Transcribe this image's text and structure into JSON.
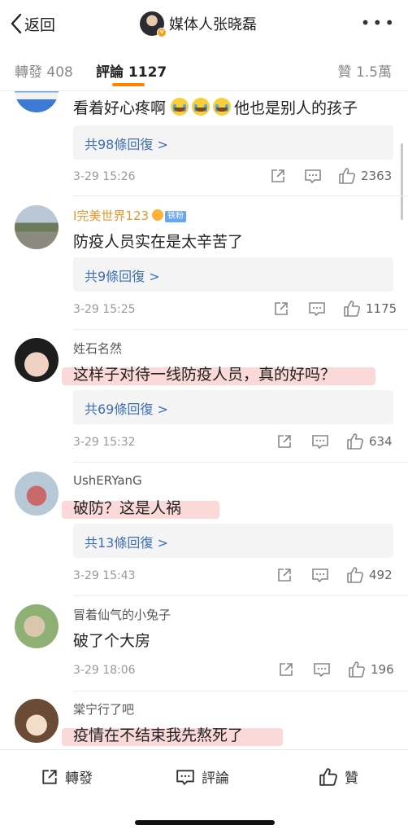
{
  "header": {
    "back_label": "返回",
    "title": "媒体人张晓磊",
    "more_label": "•••"
  },
  "tabs": [
    {
      "label": "轉發",
      "count": "408"
    },
    {
      "label": "評論",
      "count": "1127"
    },
    {
      "label": "贊",
      "count": "1.5萬"
    }
  ],
  "comments": [
    {
      "user": "",
      "text_before": "看着好心疼啊 ",
      "emoji_count": 3,
      "text_after": "他也是别人的孩子",
      "replies": "共98條回復 >",
      "time": "3-29 15:26",
      "likes": "2363"
    },
    {
      "user": "I完美世界123",
      "badge": "铁粉",
      "text": "防疫人员实在是太辛苦了",
      "replies": "共9條回復 >",
      "time": "3-29 15:25",
      "likes": "1175"
    },
    {
      "user": "姓石名然",
      "text": "这样子对待一线防疫人员，真的好吗？",
      "replies": "共69條回復 >",
      "time": "3-29 15:32",
      "likes": "634"
    },
    {
      "user": "UshERYanG",
      "text": "破防？这是人祸",
      "replies": "共13條回復 >",
      "time": "3-29 15:43",
      "likes": "492"
    },
    {
      "user": "冒着仙气的小兔子",
      "text": "破了个大房",
      "time": "3-29 18:06",
      "likes": "196"
    },
    {
      "user": "棠宁行了吧",
      "text": "疫情在不结束我先熬死了"
    }
  ],
  "bottom": {
    "repost_label": "轉發",
    "comment_label": "評論",
    "like_label": "贊"
  },
  "colors": {
    "accent": "#ff8200",
    "link": "#3e6fb6",
    "highlight": "#f8aaaa"
  }
}
